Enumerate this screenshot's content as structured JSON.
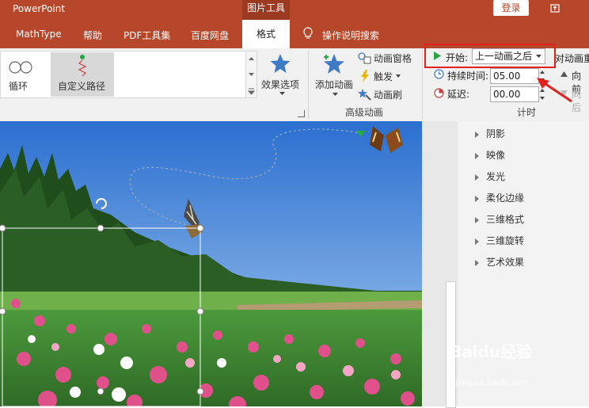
{
  "title_bar": {
    "app_name": "PowerPoint",
    "context_tab": "图片工具",
    "login": "登录"
  },
  "tabs": [
    {
      "label": "MathType"
    },
    {
      "label": "帮助"
    },
    {
      "label": "PDF工具集"
    },
    {
      "label": "百度网盘"
    },
    {
      "label": "格式"
    }
  ],
  "tell_me": "操作说明搜索",
  "ribbon": {
    "gallery": {
      "items": [
        {
          "label": "循环"
        },
        {
          "label": "自定义路径"
        }
      ]
    },
    "effect_options": "效果选项",
    "add_animation": "添加动画",
    "animation_pane": "动画窗格",
    "trigger": "触发",
    "animation_painter": "动画刷",
    "group_advanced": "高级动画",
    "timing": {
      "start_label": "开始:",
      "start_value": "上一动画之后",
      "duration_label": "持续时间:",
      "duration_value": "05.00",
      "delay_label": "延迟:",
      "delay_value": "00.00",
      "reorder_title": "对动画重",
      "move_earlier": "向前",
      "move_later": "向后",
      "group_label": "计时"
    }
  },
  "format_pane": {
    "items": [
      {
        "label": "阴影"
      },
      {
        "label": "映像"
      },
      {
        "label": "发光"
      },
      {
        "label": "柔化边缘"
      },
      {
        "label": "三维格式"
      },
      {
        "label": "三维旋转"
      },
      {
        "label": "艺术效果"
      }
    ]
  },
  "watermark": {
    "brand": "Baidu经验",
    "url": "jingyan.baidu.com"
  },
  "colors": {
    "brand": "#b7472a",
    "highlight": "#e2211c"
  }
}
